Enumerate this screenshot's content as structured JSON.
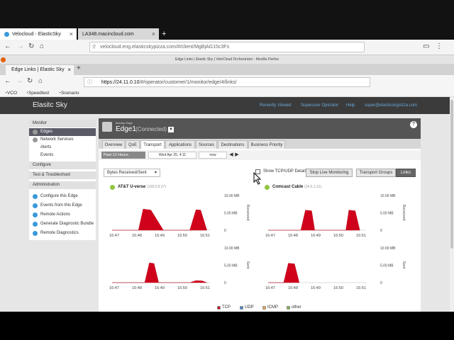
{
  "outer_browser": {
    "tabs": [
      {
        "label": "Velocloud - ElasticSky"
      },
      {
        "label": "LA348.macincloud.com"
      }
    ],
    "url": "velocloud.eng.elasticskypizza.com/#/client/MgBjAG15c3Fs"
  },
  "inner_browser": {
    "window_title": "Edge Links | Elastic Sky | VeloCloud Orchestrator - Mozilla Firefox",
    "tab_label": "Edge Links | Elastic Sky",
    "url_host": "https://24.11.0.10",
    "url_path": "/#/operator/customer/1/monitor/edge/4/links/",
    "bookmarks": [
      "VCO",
      "Speedtest",
      "Scenario"
    ]
  },
  "app": {
    "brand": "Elasitc Sky",
    "header_links": [
      "Recently Viewed",
      "Superuser Operator",
      "Help",
      "super@elasticskypizza.com"
    ],
    "sidebar": {
      "monitor": "Monitor",
      "monitor_items": [
        "Edges",
        "Network Services",
        "Alerts",
        "Events"
      ],
      "configure": "Configure",
      "test": "Test & Troubleshoot",
      "admin": "Administration",
      "admin_items": [
        "Configure this Edge",
        "Events from this Edge",
        "Remote Actions",
        "Generate Diagnostic Bundle",
        "Remote Diagnostics"
      ]
    },
    "edge": {
      "small_label": "Monitor Edge",
      "name": "Edge1",
      "status": "(Connected)"
    },
    "tabs": [
      "Overview",
      "QoE",
      "Transport",
      "Applications",
      "Sources",
      "Destinations",
      "Business Priority"
    ],
    "active_tab": "Transport",
    "time": {
      "range": "Past 12 Hours",
      "start": "Wed Apr 25, 4:11",
      "end": "now"
    },
    "metric": "Bytes Received/Sent",
    "show_tcp_label": "Show TCP/UDP Details",
    "stop_button": "Stop Live Monitoring",
    "transport_groups": "Transport Groups",
    "links_button": "Links",
    "legend": [
      "TCP",
      "UDP",
      "ICMP",
      "other"
    ],
    "legend_colors": {
      "TCP": "#d0021b",
      "UDP": "#3b7fd4",
      "ICMP": "#e8a33d",
      "other": "#7cb342"
    }
  },
  "chart_data": [
    {
      "type": "area",
      "link": "AT&T U-verse",
      "ip": "(108.9.8.37)",
      "ylabel": "Received",
      "x_ticks": [
        "16:47",
        "16:48",
        "16:49",
        "16:50",
        "16:51"
      ],
      "y_ticks": [
        "10.00 MB",
        "5.00 MB",
        "0"
      ],
      "ylim": [
        0,
        10
      ],
      "series": [
        {
          "name": "TCP",
          "x": [
            16.47,
            16.487,
            16.49,
            16.495,
            16.503,
            16.507,
            16.52,
            16.524,
            16.527,
            16.531
          ],
          "y": [
            0,
            0,
            6.1,
            5.8,
            0,
            0,
            0,
            5.9,
            5.8,
            0
          ]
        }
      ]
    },
    {
      "type": "area",
      "link": "Comcast Cable",
      "ip": "(24.5.1.31)",
      "ylabel": "Received",
      "x_ticks": [
        "16:47",
        "16:48",
        "16:49",
        "16:50",
        "16:51"
      ],
      "y_ticks": [
        "10.00 MB",
        "5.00 MB",
        "0"
      ],
      "ylim": [
        0,
        10
      ],
      "series": [
        {
          "name": "TCP",
          "x": [
            16.47,
            16.491,
            16.494,
            16.498,
            16.5,
            16.52,
            16.522,
            16.526,
            16.529
          ],
          "y": [
            0,
            0,
            5.8,
            5.6,
            0,
            0,
            5.8,
            5.6,
            0
          ]
        }
      ]
    },
    {
      "type": "area",
      "link": "",
      "ip": "",
      "ylabel": "Sent",
      "x_ticks": [
        "16:47",
        "16:48",
        "16:49",
        "16:50",
        "16:51"
      ],
      "y_ticks": [
        "10.00 MB",
        "5.00 MB",
        "0"
      ],
      "ylim": [
        0,
        10
      ],
      "series": [
        {
          "name": "TCP",
          "x": [
            16.47,
            16.491,
            16.494,
            16.497,
            16.5,
            16.52,
            16.524,
            16.528,
            16.531
          ],
          "y": [
            0,
            0,
            5.7,
            5.5,
            0,
            0,
            0.6,
            0.5,
            0
          ]
        }
      ]
    },
    {
      "type": "area",
      "link": "",
      "ip": "",
      "ylabel": "Sent",
      "x_ticks": [
        "16:47",
        "16:48",
        "16:49",
        "16:50",
        "16:51"
      ],
      "y_ticks": [
        "10.00 MB",
        "5.00 MB",
        "0"
      ],
      "ylim": [
        0,
        10
      ],
      "series": [
        {
          "name": "TCP",
          "x": [
            16.47,
            16.48,
            16.483,
            16.487,
            16.49
          ],
          "y": [
            0,
            0,
            5.6,
            5.4,
            0
          ]
        }
      ]
    }
  ]
}
